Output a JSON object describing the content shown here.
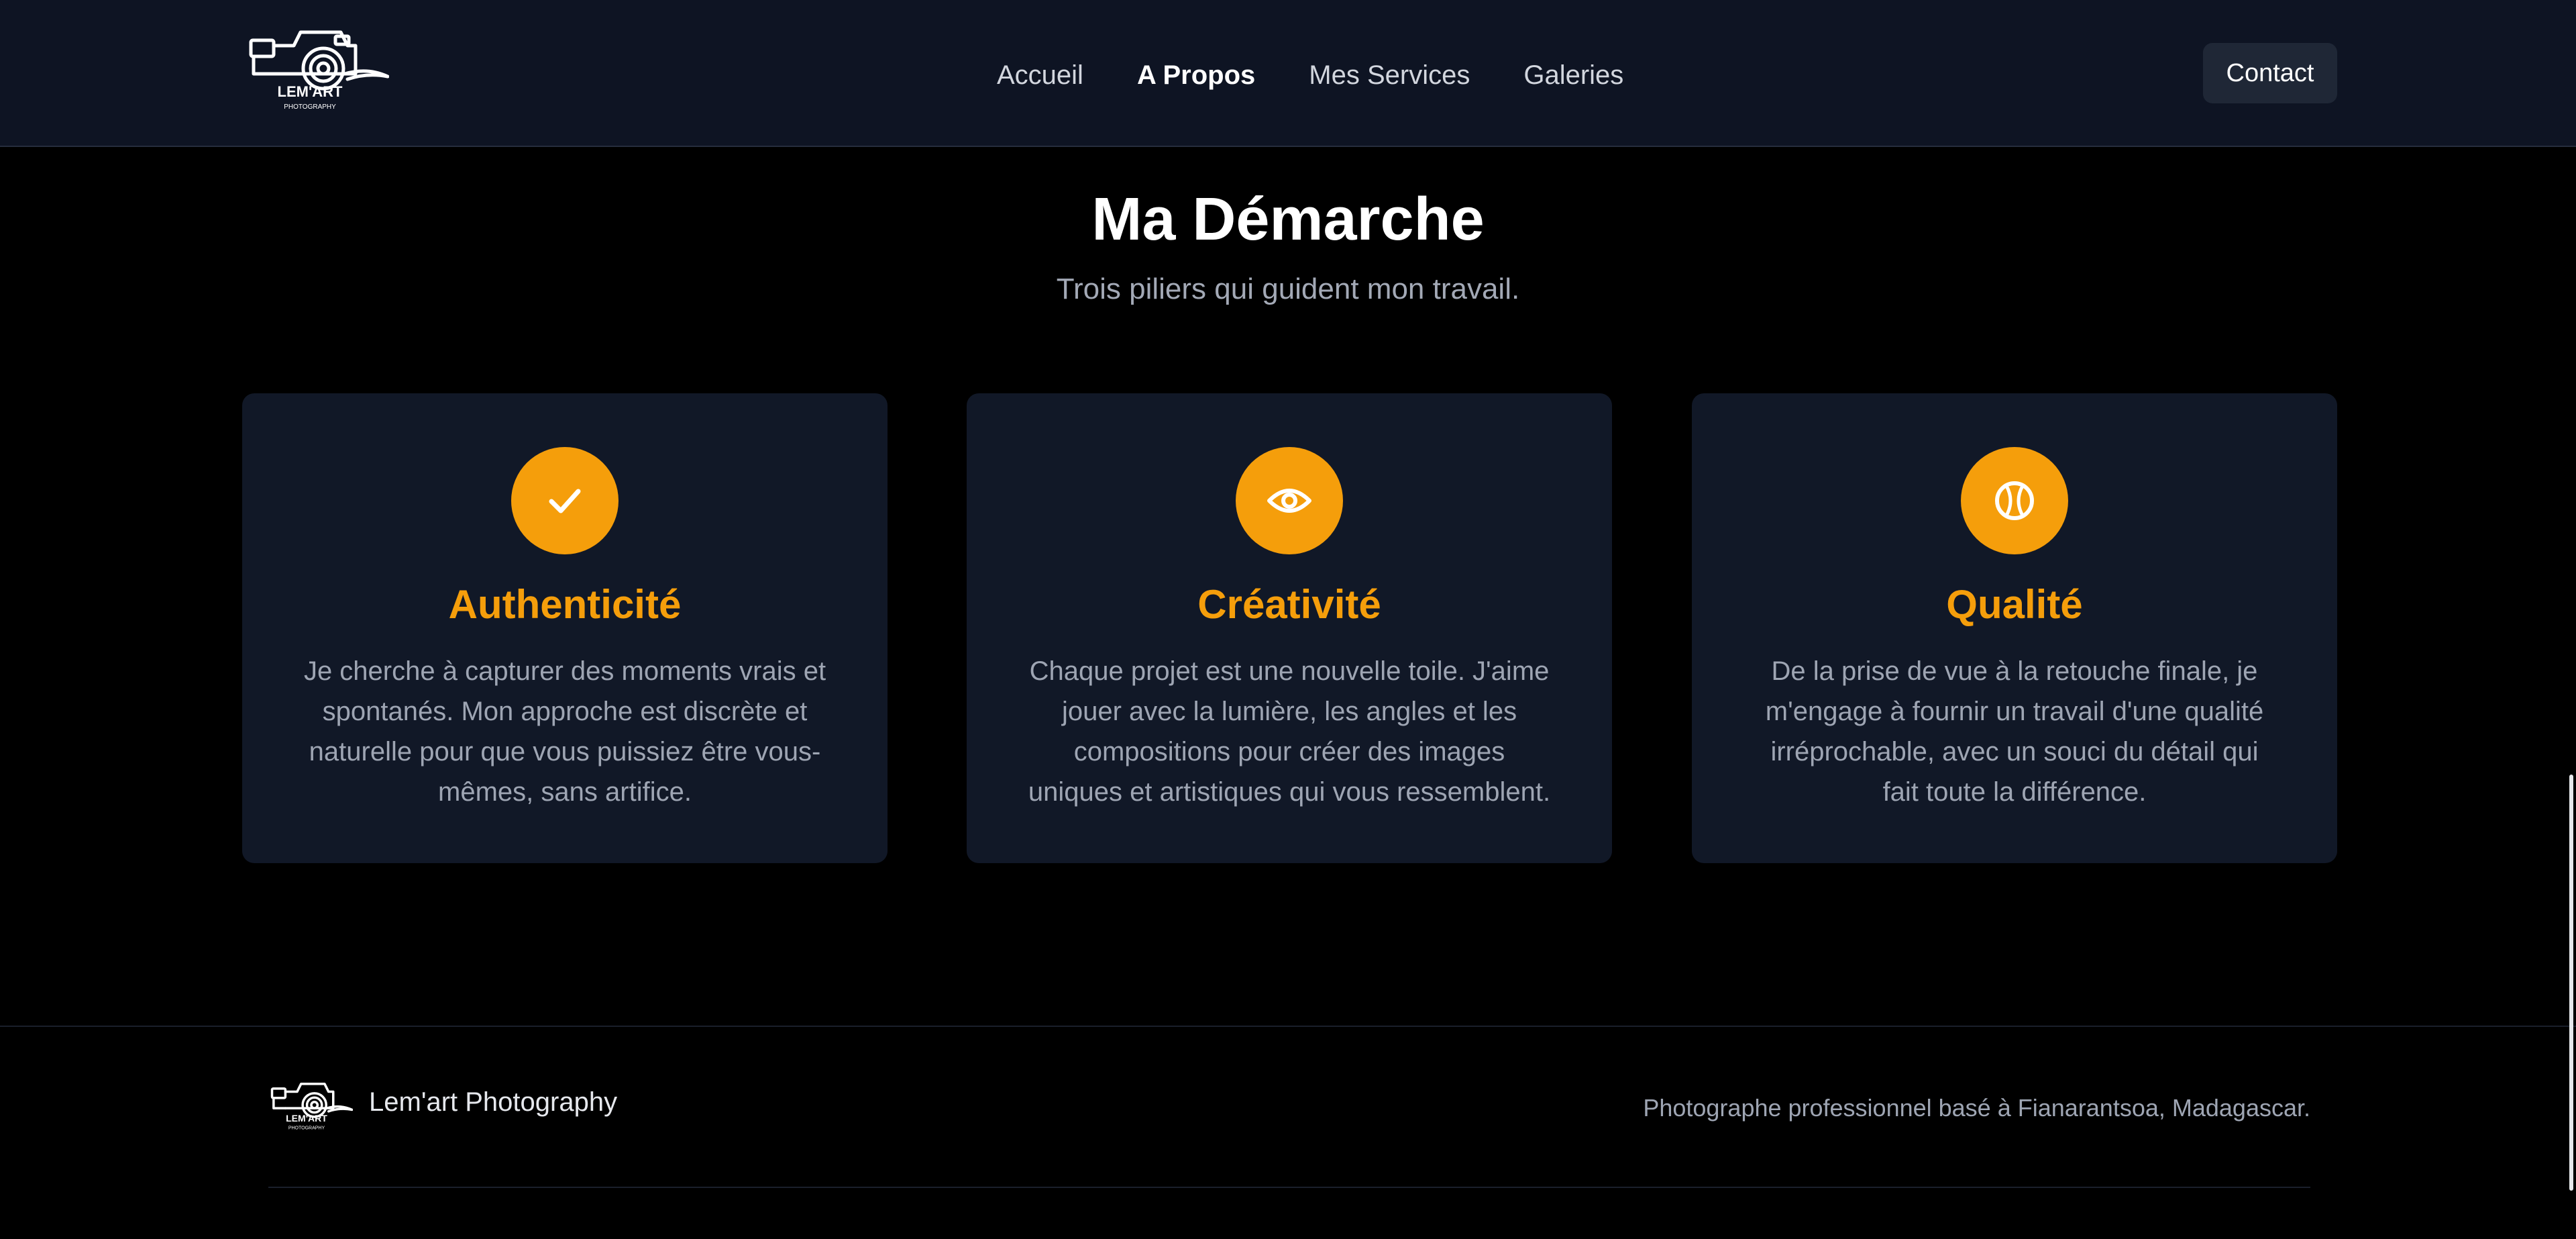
{
  "header": {
    "logo": {
      "brand": "LEM'ART",
      "sub": "PHOTOGRAPHY",
      "icon": "camera-logo-icon"
    },
    "nav": [
      {
        "label": "Accueil",
        "active": false
      },
      {
        "label": "A Propos",
        "active": true
      },
      {
        "label": "Mes Services",
        "active": false
      },
      {
        "label": "Galeries",
        "active": false
      }
    ],
    "contact_label": "Contact"
  },
  "section": {
    "title": "Ma Démarche",
    "subtitle": "Trois piliers qui guident mon travail.",
    "cards": [
      {
        "icon": "check-icon",
        "title": "Authenticité",
        "text": "Je cherche à capturer des moments vrais et spontanés. Mon approche est discrète et naturelle pour que vous puissiez être vous-mêmes, sans artifice."
      },
      {
        "icon": "eye-icon",
        "title": "Créativité",
        "text": "Chaque projet est une nouvelle toile. J'aime jouer avec la lumière, les angles et les compositions pour créer des images uniques et artistiques qui vous ressemblent."
      },
      {
        "icon": "ball-icon",
        "title": "Qualité",
        "text": "De la prise de vue à la retouche finale, je m'engage à fournir un travail d'une qualité irréprochable, avec un souci du détail qui fait toute la différence."
      }
    ]
  },
  "footer": {
    "brand": "Lem'art Photography",
    "tagline": "Photographe professionnel basé à Fianarantsoa, Madagascar."
  },
  "colors": {
    "header_bg": "#0e1423",
    "card_bg": "#111827",
    "accent": "#f59e0b",
    "page_bg": "#000000"
  }
}
